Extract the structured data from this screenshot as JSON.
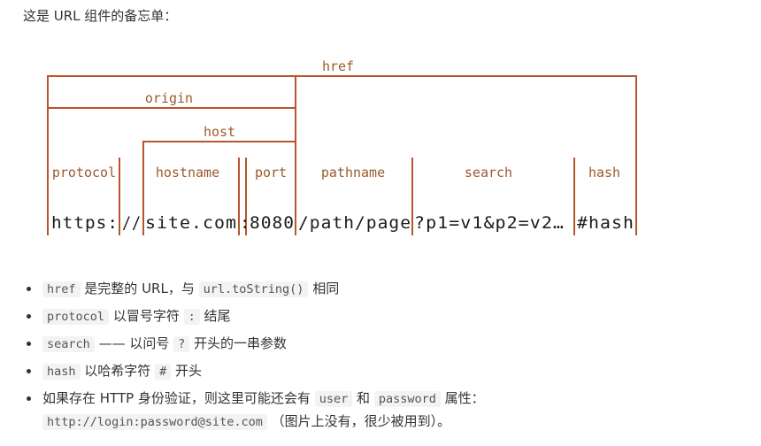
{
  "intro": "这是 URL 组件的备忘单：",
  "diagram": {
    "labels": {
      "href": "href",
      "origin": "origin",
      "host": "host",
      "protocol": "protocol",
      "hostname": "hostname",
      "port": "port",
      "pathname": "pathname",
      "search": "search",
      "hash": "hash"
    },
    "url_parts": {
      "protocol": "https:",
      "slashes": "//",
      "hostname": "site.com",
      "colon": ":",
      "port": "8080",
      "pathname": "/path/page",
      "search": "?p1=v1&p2=v2…",
      "hash": "#hash"
    },
    "line_color": "#b8552a",
    "label_color": "#9b5a2e"
  },
  "notes": [
    {
      "code": "href",
      "t1": "是完整的 URL，与",
      "code2": "url.toString()",
      "t2": "相同"
    },
    {
      "code": "protocol",
      "t1": "以冒号字符",
      "code2": ":",
      "t2": "结尾"
    },
    {
      "code": "search",
      "t1": "—— 以问号",
      "code2": "?",
      "t2": "开头的一串参数"
    },
    {
      "code": "hash",
      "t1": "以哈希字符",
      "code2": "#",
      "t2": "开头"
    },
    {
      "t0": "如果存在 HTTP 身份验证，则这里可能还会有",
      "code": "user",
      "t1": "和",
      "code2": "password",
      "t2": "属性：",
      "code3": "http://login:password@site.com",
      "t3": "（图片上没有，很少被用到）。"
    }
  ]
}
